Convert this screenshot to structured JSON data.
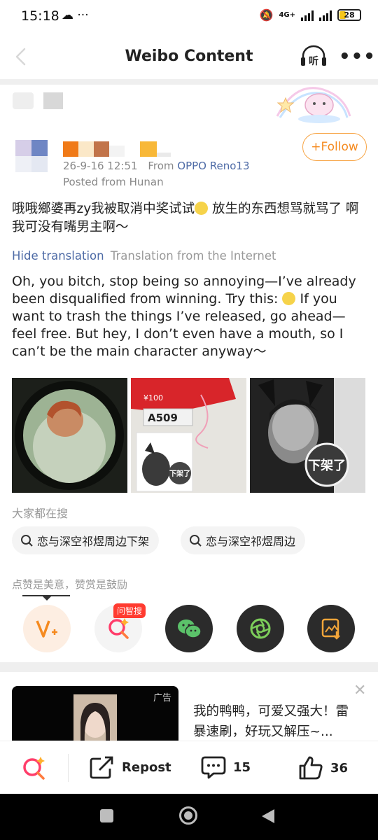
{
  "status": {
    "time": "15:18",
    "network": "4G+",
    "battery": "28"
  },
  "header": {
    "title": "Weibo Content",
    "listen_label": "听"
  },
  "author": {
    "follow_label": "+Follow",
    "date": "26-9-16 12:51",
    "from_label": "From",
    "device": "OPPO Reno13",
    "location": "Posted from Hunan"
  },
  "post": {
    "text_zh_1": "哦哦鄉婆再zy我被取消中奖试试",
    "text_zh_2": " 放生的东西想骂就骂了 啊 我可没有嘴男主啊～",
    "hide_translation": "Hide translation",
    "translation_source": "Translation from the Internet",
    "text_en_1": "Oh, you bitch, stop being so annoying—I’ve already been disqualified from winning. Try this: ",
    "text_en_2": " If you want to trash the things I’ve released, go ahead—feel free. But hey, I don’t even have a mouth, so I can’t be the main character anyway～",
    "image2_label": "A509",
    "image2_price": "¥100",
    "stamp_text": "下架了"
  },
  "search": {
    "heading": "大家都在搜",
    "chips": [
      "恋与深空祁煜周边下架",
      "恋与深空祁煜周边"
    ]
  },
  "actions": {
    "like_tip": "点赞是美意，赞赏是鼓励",
    "badge": "问智搜"
  },
  "ad": {
    "tag": "广告",
    "text": "我的鸭鸭，可爱又强大！雷暴速刷，好玩又解压~..."
  },
  "bottom": {
    "repost_label": "Repost",
    "comments": "15",
    "likes": "36"
  },
  "colors": {
    "accent": "#f58a1f",
    "link": "#4e6ba6",
    "badge_red": "#ff3b30"
  }
}
